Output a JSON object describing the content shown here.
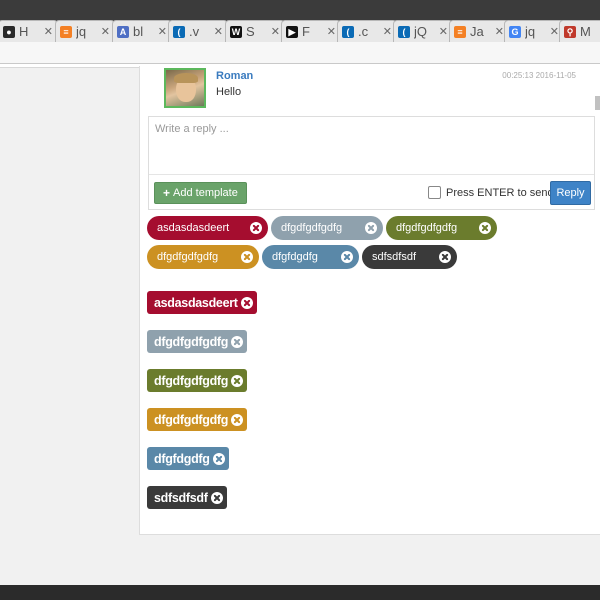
{
  "browser": {
    "tabs": [
      {
        "title": "H",
        "icon": "panda-icon",
        "color": "#2a2a2a"
      },
      {
        "title": "jq",
        "icon": "stackoverflow-icon",
        "color": "#f48024"
      },
      {
        "title": "bl",
        "icon": "a-letter-icon",
        "color": "#4f6fc4"
      },
      {
        "title": ".v",
        "icon": "jquery-icon",
        "color": "#0a6ab5"
      },
      {
        "title": "S",
        "icon": "w-square-icon",
        "color": "#111111"
      },
      {
        "title": "F",
        "icon": "flag-icon",
        "color": "#111111"
      },
      {
        "title": ".c",
        "icon": "jquery-icon",
        "color": "#0a6ab5"
      },
      {
        "title": "jQ",
        "icon": "jquery-icon",
        "color": "#0a6ab5"
      },
      {
        "title": "Ja",
        "icon": "stackoverflow-icon",
        "color": "#f48024"
      },
      {
        "title": "jq",
        "icon": "google-icon",
        "color": "#4285f4"
      },
      {
        "title": "M",
        "icon": "antenna-icon",
        "color": "#c0392b"
      }
    ],
    "close_glyph": "✕"
  },
  "message": {
    "author": "Roman",
    "timestamp": "00:25:13 2016-11-05",
    "text": "Hello"
  },
  "reply": {
    "placeholder": "Write a reply ...",
    "add_template_label": "Add template",
    "add_template_icon": "+",
    "enter_to_send_label": "Press ENTER to send",
    "reply_button_label": "Reply"
  },
  "pill_tags": [
    {
      "label": "asdasdasdeert",
      "color": "#a50d2f"
    },
    {
      "label": "dfgdfgdfgdfg",
      "color": "#8fa1ad"
    },
    {
      "label": "dfgdfgdfgdfg",
      "color": "#6b7c2d"
    },
    {
      "label": "dfgdfgdfgdfg",
      "color": "#cc9122"
    },
    {
      "label": "dfgfdgdfg",
      "color": "#5a88a8"
    },
    {
      "label": "sdfsdfsdf",
      "color": "#3a3a3a"
    }
  ],
  "label_tags": [
    {
      "label": "asdasdasdeert",
      "color": "#a50d2f"
    },
    {
      "label": "dfgdfgdfgdfg",
      "color": "#8fa1ad"
    },
    {
      "label": "dfgdfgdfgdfg",
      "color": "#6b7c2d"
    },
    {
      "label": "dfgdfgdfgdfg",
      "color": "#cc9122"
    },
    {
      "label": "dfgfdgdfg",
      "color": "#5a88a8"
    },
    {
      "label": "sdfsdfsdf",
      "color": "#3a3a3a"
    }
  ]
}
